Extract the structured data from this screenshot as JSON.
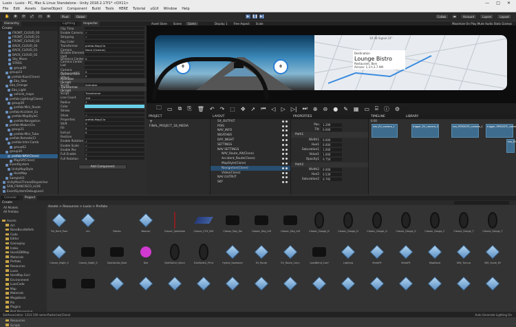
{
  "window": {
    "title": "Luxio - Luxio - PC, Mac & Linux Standalone - Unity 2018.2.17f1* <DX11>",
    "controls": [
      "—",
      "□",
      "✕"
    ]
  },
  "menu": [
    "File",
    "Edit",
    "Assets",
    "GameObject",
    "Component",
    "Build",
    "Tools",
    "HERE",
    "Tutorial",
    "uGUI",
    "Window",
    "Help"
  ],
  "toolbar": {
    "pivot": "Pivot",
    "global": "Global",
    "collab": "Collab",
    "account": "Account",
    "layers": "Layers",
    "layout": "Layout"
  },
  "hierarchy": {
    "tabs": [
      "Hierarchy",
      "Lighting",
      "Inspector"
    ],
    "create": "Create",
    "items": [
      "FRONT_CLOUD_00",
      "FRONT_CLOUD_01",
      "FRONT_CLOUD_02",
      "BACK_CLOUD_00",
      "BACK_CLOUD_01",
      "BACK_CLOUD_02",
      "Sky_Moon",
      "STARS",
      "group39",
      "group23",
      "prefab-Kaar(Clone)",
      "Ebo_Skw",
      "Ebo_Orange",
      "Ebo_Light",
      "vehicle_maps",
      "prefab-Lighting(Clone)",
      "group39",
      "prefab-Mini_Route",
      "prefab-Accident_Ev",
      "prefab-MapStyleC",
      "prefab-Navigation",
      "prefab-Maker(Clo",
      "group21",
      "prefab-Mini_Tube",
      "prefab-Remote(Cl",
      "prefab-Infer-Camb",
      "group62",
      "group34",
      "prefab-NAV(Clone)",
      "MapStf(Clone)",
      "EventSystem",
      "UnityMapStyle",
      "HereMap",
      "Sample01",
      "UnityMainThreadDispatcher",
      "SAN_FRANCISCO_LUXE",
      "EventSystemDebugLand"
    ]
  },
  "inspector": {
    "rows": [
      {
        "label": "Clip Time",
        "value": ""
      },
      {
        "label": "Enable Camera",
        "value": "✓"
      },
      {
        "label": "Stripping",
        "value": "✓"
      },
      {
        "label": "Ray Color",
        "value": ""
      },
      {
        "label": "Transformer",
        "value": "prefab-Map(Clo"
      },
      {
        "label": "Camera",
        "value": "None (Camera)"
      },
      {
        "label": "Disable Element (spl)",
        "value": ""
      },
      {
        "label": "Distance Center",
        "value": "0"
      },
      {
        "label": "Camera Center Lad",
        "value": ""
      },
      {
        "label": "",
        "value": ""
      },
      {
        "label": "Camera Distance OFS",
        "value": "0"
      },
      {
        "label": "Camera Pitch Offset",
        "value": "0"
      },
      {
        "label": "Animator (Script)",
        "value": "",
        "hdr": true
      },
      {
        "label": "Script",
        "value": "Animator"
      },
      {
        "label": "Transformer (Script)",
        "value": "",
        "hdr": true
      },
      {
        "label": "Script",
        "value": "Transformer"
      },
      {
        "label": "Line Count",
        "value": "100"
      },
      {
        "label": "Radius",
        "value": "3"
      },
      {
        "label": "Color",
        "value": ""
      },
      {
        "label": "Stroke",
        "value": ""
      },
      {
        "label": "Show",
        "value": "✓"
      },
      {
        "label": "Properties",
        "value": "prefab-Map(Clo"
      },
      {
        "label": "Shift",
        "value": "0"
      },
      {
        "label": "Fill",
        "value": "0"
      },
      {
        "label": "Extrud",
        "value": "0"
      },
      {
        "label": "Position",
        "value": ""
      },
      {
        "label": "Enable Rotation",
        "value": "✓"
      },
      {
        "label": "Enable Scale",
        "value": "✓"
      },
      {
        "label": "Enable Pos",
        "value": "✓"
      },
      {
        "label": "Full Enable",
        "value": "✓"
      },
      {
        "label": "Full Rotation",
        "value": "0"
      }
    ],
    "add_component": "Add Component"
  },
  "game": {
    "tabs": [
      "Asset Store",
      "Scene",
      "Game"
    ],
    "display": "Display 1",
    "free_aspect": "Free Aspect",
    "scale": "Scale",
    "right_labels": "Maximize On Play   Mute Audio   Stats   Gizmos",
    "dest_label": "Destination",
    "dest_name": "Lounge Bistro",
    "dest_addr": "Restaurant, Bars",
    "dest_eta": "Arrives: 1.3 h 2.7 AM",
    "topbar": "10:38   Signal  23°",
    "speed_left": "0",
    "speed_right": "0"
  },
  "editor": {
    "project_header": "PROJECT",
    "project_item": "FINAL_PROJECT_1B_MEDIA",
    "layout_header": "LAYOUT",
    "layers": [
      "SX_OUTPUT",
      "POIS",
      "NAV_INFO",
      "WEATHER",
      "DAY_NIGHT",
      "SETTINGS",
      "NAV SETTINGS",
      "NAV_Route_Alt(Clone)",
      "Accident_Route(Clone)",
      "MapStyle(Clone)",
      "Navigation(Clone)",
      "Video(Clone)",
      "NAV OUTPUT",
      "SKY"
    ],
    "properties_header": "PROPERTIES",
    "props": [
      {
        "label": "Pan",
        "value": "1.299"
      },
      {
        "label": "Tilt",
        "value": "0.000"
      },
      {
        "label": "Path1",
        "value": "",
        "grp": true
      },
      {
        "label": "Width1",
        "value": "0.000"
      },
      {
        "label": "Hue1",
        "value": "0.000"
      },
      {
        "label": "Saturation1",
        "value": "1.000"
      },
      {
        "label": "Value1",
        "value": "1.000"
      },
      {
        "label": "Opacity1",
        "value": "0.750"
      },
      {
        "label": "Path2",
        "value": "",
        "grp": true
      },
      {
        "label": "Width2",
        "value": "0.000"
      },
      {
        "label": "Hue2",
        "value": "0.539"
      },
      {
        "label": "Saturation2",
        "value": "0.795"
      }
    ],
    "timeline_header": "TIMELINE",
    "library_header": "LIBRARY",
    "time": "0.00",
    "tracks": [
      "nav_EV_camera_1",
      "trigger_EV_camera_0",
      "nav_PERSISTE_camera_1",
      "trigger_PERSISTE_camera_1",
      "nav_ENVIRONMENT"
    ]
  },
  "project_panel": {
    "tabs": [
      "Console",
      "Project"
    ],
    "create": "Create",
    "breadcrumb": "Assets > Resources > Luxio > Prefabs",
    "favorites": [
      "All Models",
      "All Prefabs"
    ],
    "folders": [
      "Assets",
      "Art",
      "BoneBundleRefs",
      "Code",
      "Editor",
      "Gameplay",
      "Index",
      "HereSDKMap",
      "Materials",
      "Prefabs",
      "Resources",
      "Luxio",
      "HereMap Excl",
      "Environment",
      "LuxeCode",
      "Map",
      "Materials",
      "Megablock",
      "Pin",
      "Plugins",
      "Post Processing",
      "Prefabs",
      "Resources",
      "Scripts"
    ],
    "row1": [
      "Fol_Dent_Post",
      "Arc",
      "Blocks",
      "Beacon",
      "Classic_Speedom",
      "Classic_COY_WG",
      "Classic_Day_Da",
      "Classic_Day_Infl",
      "Classic_Day_Infl",
      "Classic_Gauge_D",
      "Classic_Gauge_D",
      "Classic_Gauge_H",
      "Classic_Gauge_S",
      "Classic_Gauge_C",
      "Classic_Gauge_T",
      "Classic_Gauge_T"
    ],
    "row2": [
      "Classic_Night_S",
      "Classic_Night_S",
      "DashAudio_Bold",
      "Dial",
      "DialSwitch_Bund",
      "DialSwitch_Print",
      "Hybrid_Speedom",
      "EV_Route",
      "EV_Route_Conn",
      "LoadBend_Conf",
      "Lighting",
      "MetaFR",
      "MetaFR",
      "MapBand",
      "Milt_Turnup",
      "Milt_Scale_Mi"
    ],
    "row3": [
      "",
      "",
      "",
      "",
      "",
      "",
      "",
      "",
      "",
      "",
      "",
      "",
      "",
      "",
      "",
      ""
    ]
  },
  "status": {
    "left": "SetAssociation: 1314 106 name:Raster(as(Clone)",
    "right": "Auto Generate Lighting On"
  }
}
